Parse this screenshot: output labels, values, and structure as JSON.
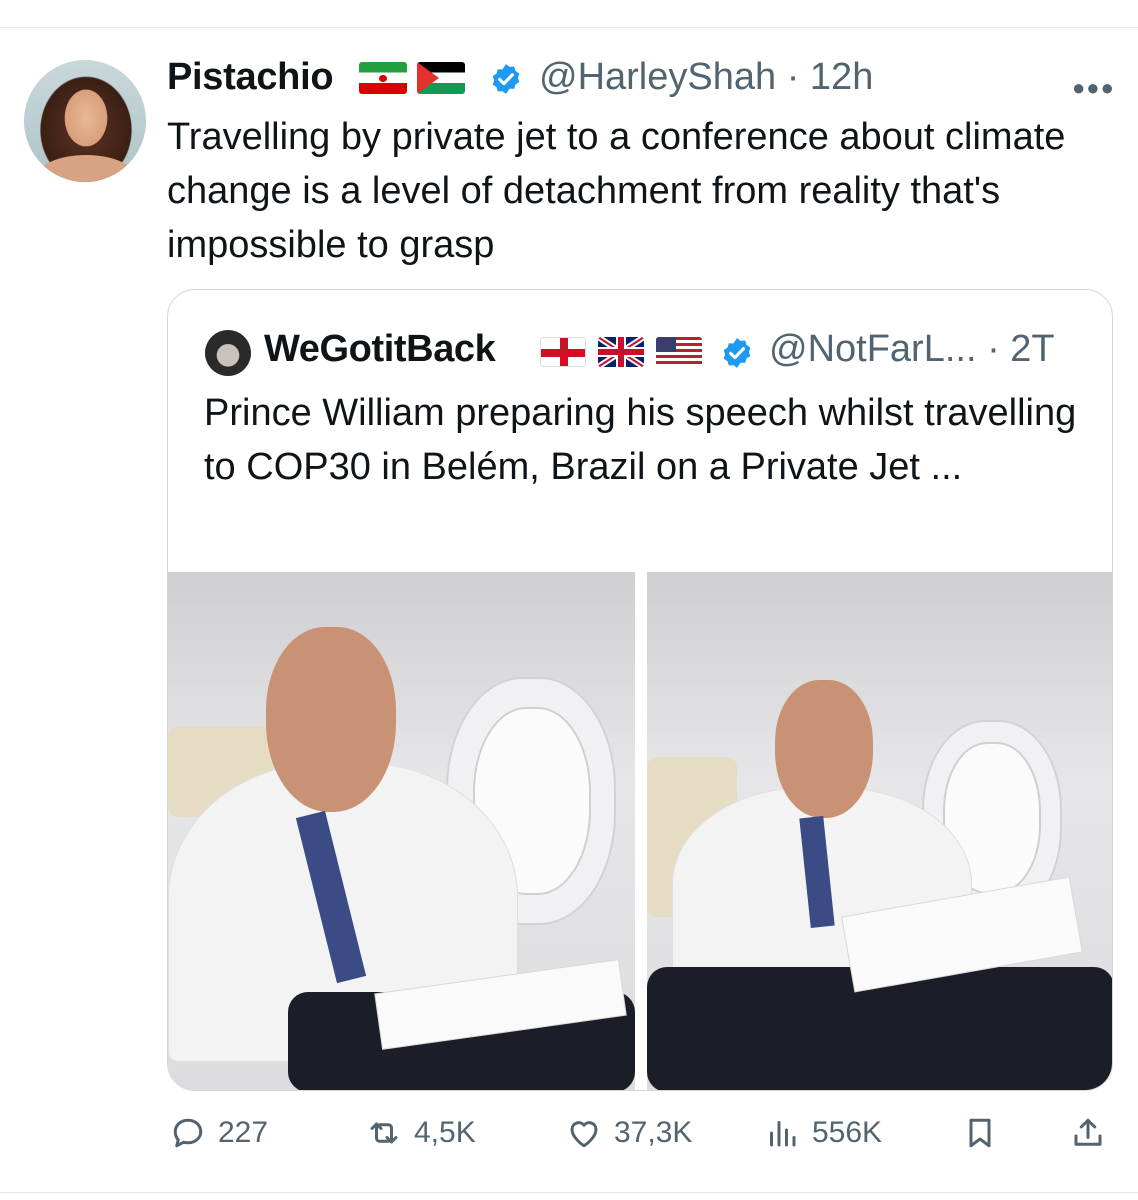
{
  "post": {
    "author_name": "Pistachio",
    "author_flags": [
      "iran-flag",
      "palestine-flag"
    ],
    "handle": "@HarleyShah",
    "separator": "·",
    "time": "12h",
    "text": "Travelling by private jet to a conference about climate change is a level of detachment from reality that's impossible to grasp"
  },
  "quote": {
    "author_name": "WeGotitBack",
    "author_flags": [
      "england-flag",
      "uk-flag",
      "us-flag"
    ],
    "handle": "@NotFarL...",
    "separator": "·",
    "time": "2T",
    "text": "Prince William preparing his speech whilst travelling to COP30 in Belém, Brazil on a Private Jet ..."
  },
  "actions": {
    "replies": "227",
    "reposts": "4,5K",
    "likes": "37,3K",
    "views": "556K"
  },
  "colors": {
    "verified_badge": "#1d9bf0",
    "secondary_text": "#536471",
    "border": "#cfd9de"
  },
  "icons": [
    "more-icon",
    "verified-badge-icon",
    "reply-icon",
    "repost-icon",
    "like-icon",
    "views-icon",
    "bookmark-icon",
    "share-icon"
  ]
}
